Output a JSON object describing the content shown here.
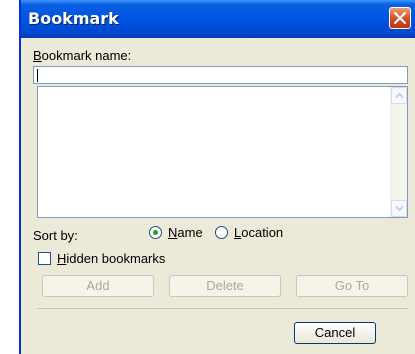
{
  "dialog": {
    "title": "Bookmark",
    "name_label": "Bookmark name:",
    "name_value": "",
    "sort_label": "Sort by:",
    "sort_options": [
      "Name",
      "Location"
    ],
    "sort_selected": "Name",
    "hidden_label": "Hidden bookmarks",
    "hidden_checked": false,
    "buttons": {
      "add": "Add",
      "delete": "Delete",
      "goto": "Go To",
      "cancel": "Cancel"
    }
  },
  "colors": {
    "title_bar": "#0054e3",
    "close_button": "#d1431c",
    "dialog_bg": "#ece9d8"
  },
  "icons": [
    "close-icon",
    "scroll-up-arrow-icon",
    "scroll-down-arrow-icon"
  ]
}
